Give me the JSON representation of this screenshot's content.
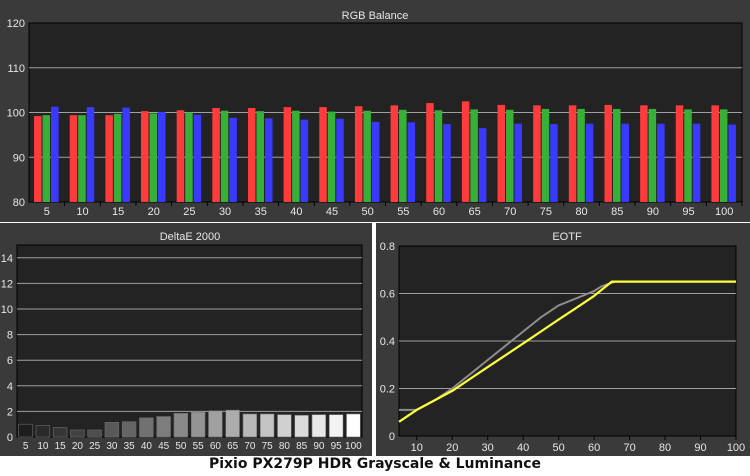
{
  "colors": {
    "panel_bg": "#3a3a3a",
    "plot_bg": "#232323",
    "grid": "#a0a0a0",
    "red": "#ff3b3b",
    "green": "#36b036",
    "blue": "#3a3aff",
    "eotf_reference": "#8c8c8c",
    "eotf_measured": "#ffff3a"
  },
  "caption": "Pixio PX279P HDR Grayscale & Luminance",
  "chart_data": [
    {
      "type": "bar",
      "title": "RGB Balance",
      "categories": [
        "5",
        "10",
        "15",
        "20",
        "25",
        "30",
        "35",
        "40",
        "45",
        "50",
        "55",
        "60",
        "65",
        "70",
        "75",
        "80",
        "85",
        "90",
        "95",
        "100"
      ],
      "ylim": [
        80,
        120
      ],
      "yticks": [
        80,
        90,
        100,
        110,
        120
      ],
      "grid": true,
      "series": [
        {
          "color": "red",
          "values": [
            99.2,
            99.4,
            99.4,
            100.3,
            100.5,
            101.0,
            101.0,
            101.2,
            101.2,
            101.4,
            101.6,
            102.1,
            102.5,
            101.7,
            101.6,
            101.6,
            101.7,
            101.6,
            101.6,
            101.6
          ]
        },
        {
          "color": "green",
          "values": [
            99.4,
            99.4,
            99.7,
            99.8,
            100.0,
            100.4,
            100.3,
            100.4,
            100.2,
            100.4,
            100.6,
            100.5,
            100.7,
            100.6,
            100.8,
            100.8,
            100.8,
            100.8,
            100.7,
            100.7
          ]
        },
        {
          "color": "blue",
          "values": [
            101.3,
            101.2,
            101.1,
            100.1,
            99.5,
            98.8,
            98.7,
            98.4,
            98.6,
            97.9,
            97.8,
            97.4,
            96.5,
            97.5,
            97.4,
            97.5,
            97.5,
            97.5,
            97.5,
            97.3
          ]
        }
      ]
    },
    {
      "type": "bar",
      "title": "DeltaE 2000",
      "categories": [
        "5",
        "10",
        "15",
        "20",
        "25",
        "30",
        "35",
        "40",
        "45",
        "50",
        "55",
        "60",
        "65",
        "70",
        "75",
        "80",
        "85",
        "90",
        "95",
        "100"
      ],
      "ylim": [
        0,
        15
      ],
      "yticks": [
        0,
        2,
        4,
        6,
        8,
        10,
        12,
        14
      ],
      "grid": true,
      "values": [
        1.0,
        0.9,
        0.75,
        0.55,
        0.55,
        1.15,
        1.2,
        1.5,
        1.6,
        1.85,
        1.95,
        2.05,
        2.1,
        1.8,
        1.8,
        1.75,
        1.7,
        1.75,
        1.75,
        1.8
      ]
    },
    {
      "type": "line",
      "title": "EOTF",
      "xlim": [
        5,
        100
      ],
      "xticks": [
        10,
        20,
        30,
        40,
        50,
        60,
        70,
        80,
        90,
        100
      ],
      "ylim": [
        0,
        0.8
      ],
      "yticks": [
        0,
        0.2,
        0.4,
        0.6,
        0.8
      ],
      "grid": true,
      "series": [
        {
          "color": "eotf_reference",
          "x": [
            5,
            10,
            15,
            20,
            25,
            30,
            35,
            40,
            45,
            50,
            55,
            60,
            62,
            64,
            66,
            70,
            80,
            90,
            100
          ],
          "y": [
            0.11,
            0.11,
            0.15,
            0.2,
            0.26,
            0.32,
            0.38,
            0.44,
            0.5,
            0.55,
            0.58,
            0.61,
            0.63,
            0.64,
            0.65,
            0.65,
            0.65,
            0.65,
            0.65
          ]
        },
        {
          "color": "eotf_measured",
          "x": [
            5,
            10,
            15,
            20,
            25,
            30,
            35,
            40,
            45,
            50,
            55,
            60,
            65,
            70,
            80,
            90,
            100
          ],
          "y": [
            0.06,
            0.11,
            0.15,
            0.19,
            0.24,
            0.29,
            0.34,
            0.39,
            0.44,
            0.49,
            0.54,
            0.59,
            0.65,
            0.65,
            0.65,
            0.65,
            0.65
          ]
        }
      ]
    }
  ]
}
